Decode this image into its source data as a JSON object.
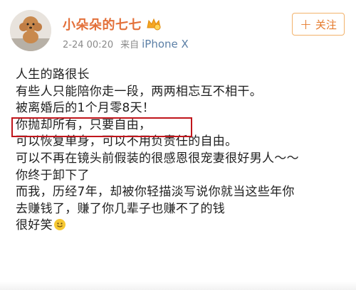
{
  "user": {
    "name": "小朵朵的七七",
    "avatar": "poodle-dog-avatar",
    "badge": "vip-icon"
  },
  "meta": {
    "time": "2-24 00:20",
    "from_label": "来自",
    "device": "iPhone X"
  },
  "follow_button": {
    "icon": "plus-icon",
    "label": "关注"
  },
  "post": {
    "lines": [
      "人生的路很长",
      "有些人只能陪你走一段，两两相忘互不相干。",
      "被离婚后的1个月零8天！",
      "你抛却所有，只要自由，",
      "可以恢复单身，可以不用负责任的自由。",
      "可以不再在镜头前假装的很感恩很宠妻很好男人～～",
      "你终于卸下了",
      "而我，历经7年，却被你轻描淡写说你就当这些年你",
      "去赚钱了，赚了你几辈子也赚不了的钱",
      "很好笑"
    ],
    "emoji": "smile-emoji-icon"
  },
  "colors": {
    "username": "#e3703a",
    "follow_border": "#f2b26b",
    "highlight_box": "#c0151b",
    "device_link": "#5b7fa6"
  }
}
